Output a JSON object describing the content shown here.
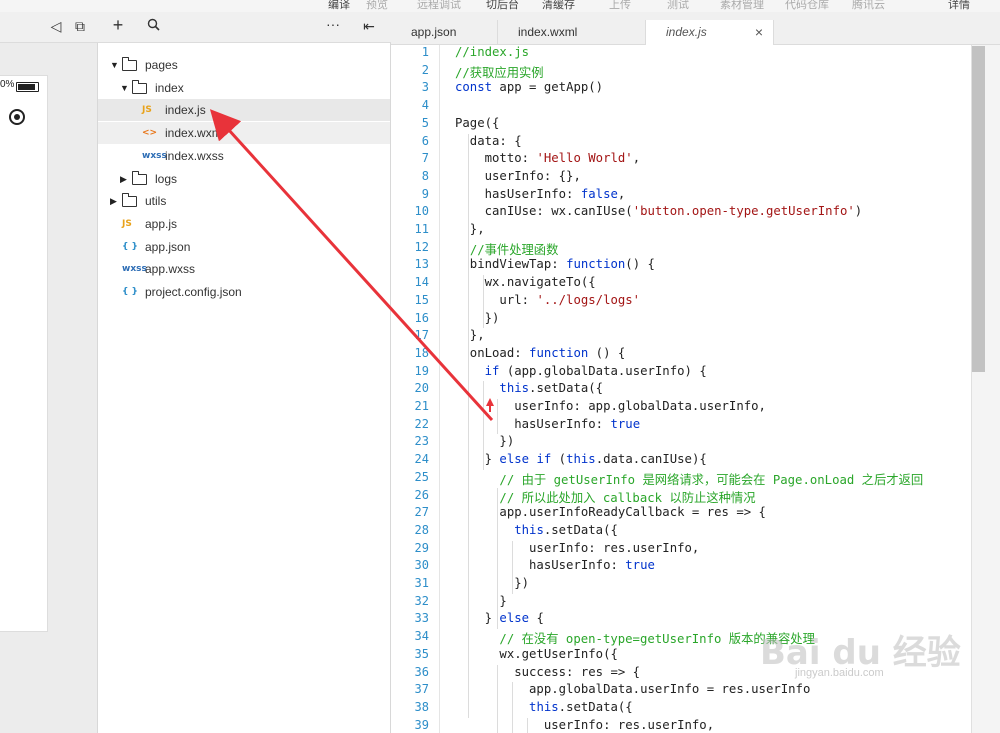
{
  "top_menu": [
    {
      "label": "编译",
      "dim": false
    },
    {
      "label": "预览",
      "dim": true
    },
    {
      "label": "远程调试",
      "dim": true
    },
    {
      "label": "切后台",
      "dim": false
    },
    {
      "label": "清缓存",
      "dim": false
    },
    {
      "label": "上传",
      "dim": true
    },
    {
      "label": "测试",
      "dim": true
    },
    {
      "label": "素材管理",
      "dim": true
    },
    {
      "label": "代码仓库",
      "dim": true
    },
    {
      "label": "腾讯云",
      "dim": true
    },
    {
      "label": "详情",
      "dim": false
    }
  ],
  "simulator": {
    "battery_text": "0%"
  },
  "file_tree": [
    {
      "label": "pages",
      "type": "folder",
      "open": true,
      "depth": 0
    },
    {
      "label": "index",
      "type": "folder",
      "open": true,
      "depth": 1
    },
    {
      "label": "index.js",
      "type": "js",
      "depth": 2,
      "selected": true
    },
    {
      "label": "index.wxml",
      "type": "wxml",
      "depth": 2,
      "hover": true
    },
    {
      "label": "index.wxss",
      "type": "wxss",
      "depth": 2
    },
    {
      "label": "logs",
      "type": "folder",
      "open": false,
      "depth": 1
    },
    {
      "label": "utils",
      "type": "folder",
      "open": false,
      "depth": 0
    },
    {
      "label": "app.js",
      "type": "js",
      "depth": 0
    },
    {
      "label": "app.json",
      "type": "json",
      "depth": 0
    },
    {
      "label": "app.wxss",
      "type": "wxss",
      "depth": 0
    },
    {
      "label": "project.config.json",
      "type": "json",
      "depth": 0
    }
  ],
  "file_icons": {
    "js": "JS",
    "wxml": "<>",
    "wxss": "wxss",
    "json": "{ }"
  },
  "tabs": [
    {
      "label": "app.json",
      "active": false
    },
    {
      "label": "index.wxml",
      "active": false
    },
    {
      "label": "index.js",
      "active": true
    }
  ],
  "tab_close": "×",
  "code_lines": [
    "//index.js",
    "//获取应用实例",
    "const app = getApp()",
    "",
    "Page({",
    "  data: {",
    "    motto: 'Hello World',",
    "    userInfo: {},",
    "    hasUserInfo: false,",
    "    canIUse: wx.canIUse('button.open-type.getUserInfo')",
    "  },",
    "  //事件处理函数",
    "  bindViewTap: function() {",
    "    wx.navigateTo({",
    "      url: '../logs/logs'",
    "    })",
    "  },",
    "  onLoad: function () {",
    "    if (app.globalData.userInfo) {",
    "      this.setData({",
    "        userInfo: app.globalData.userInfo,",
    "        hasUserInfo: true",
    "      })",
    "    } else if (this.data.canIUse){",
    "      // 由于 getUserInfo 是网络请求，可能会在 Page.onLoad 之后才返回",
    "      // 所以此处加入 callback 以防止这种情况",
    "      app.userInfoReadyCallback = res => {",
    "        this.setData({",
    "          userInfo: res.userInfo,",
    "          hasUserInfo: true",
    "        })",
    "      }",
    "    } else {",
    "      // 在没有 open-type=getUserInfo 版本的兼容处理",
    "      wx.getUserInfo({",
    "        success: res => {",
    "          app.globalData.userInfo = res.userInfo",
    "          this.setData({",
    "            userInfo: res.userInfo,"
  ],
  "watermark": {
    "main": "Bai du 经验",
    "sub": "jingyan.baidu.com"
  },
  "colors": {
    "line_number": "#2d8ec9",
    "comment": "#2aa62a",
    "string": "#a31515",
    "keyword": "#0033cc",
    "annotation_arrow": "#e8333a"
  }
}
